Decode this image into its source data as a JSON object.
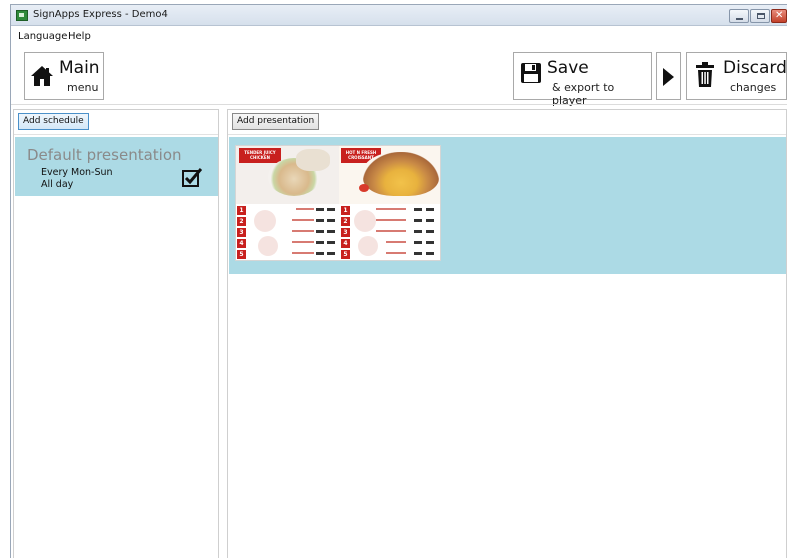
{
  "window": {
    "title": "SignApps Express - Demo4"
  },
  "menu": {
    "items": [
      "Language",
      "Help"
    ]
  },
  "toolbar": {
    "main": {
      "title": "Main",
      "subtitle": "menu",
      "icon": "home-icon"
    },
    "save": {
      "title": "Save",
      "subtitle": "& export to player",
      "icon": "floppy-disk-icon"
    },
    "export_arrow": {
      "icon": "play-arrow-icon"
    },
    "discard": {
      "title": "Discard",
      "subtitle": "changes",
      "icon": "trash-icon"
    }
  },
  "schedules": {
    "add_label": "Add schedule",
    "items": [
      {
        "title": "Default presentation",
        "days": "Every Mon-Sun",
        "time": "All day",
        "checked": true
      }
    ]
  },
  "presentations": {
    "add_label": "Add presentation",
    "thumbnails": [
      {
        "left_tag": "TENDER JUICY CHICKEN",
        "right_tag": "HOT N FRESH CROISSANT",
        "row_numbers": [
          "1",
          "2",
          "3",
          "4",
          "5"
        ]
      }
    ]
  },
  "colors": {
    "selection_bg": "#acdae5",
    "accent_red": "#c8201e"
  }
}
